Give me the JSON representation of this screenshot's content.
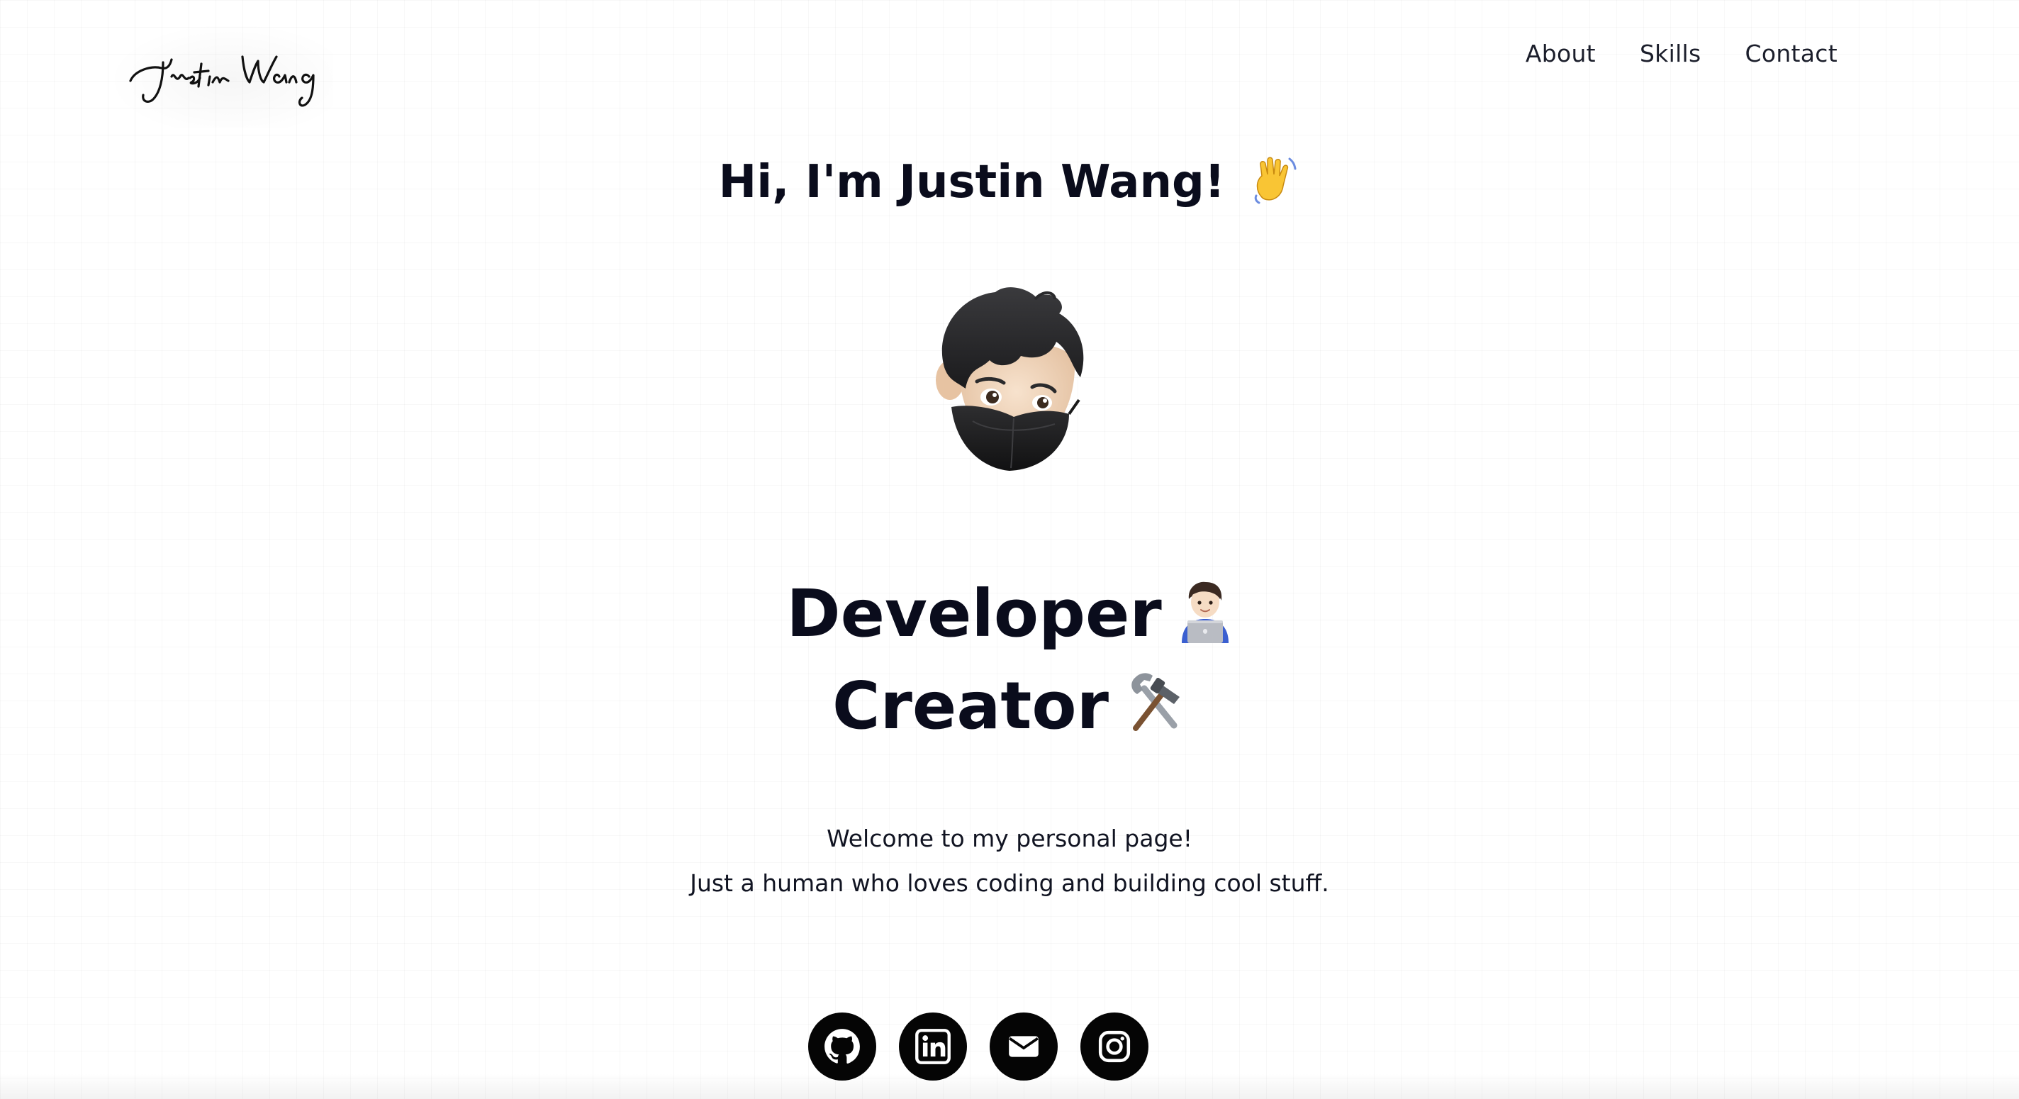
{
  "header": {
    "logo_text": "Justin Wang",
    "nav": [
      "About",
      "Skills",
      "Contact"
    ]
  },
  "hero": {
    "greeting": "Hi, I'm Justin Wang!",
    "greeting_emoji": "waving-hand",
    "roles": [
      {
        "label": "Developer",
        "emoji": "technologist-laptop"
      },
      {
        "label": "Creator",
        "emoji": "hammer-and-wrench"
      }
    ],
    "intro": [
      "Welcome to my personal page!",
      "Just a human who loves coding and building cool stuff."
    ]
  },
  "social": [
    {
      "icon": "github-icon"
    },
    {
      "icon": "linkedin-icon"
    },
    {
      "icon": "email-icon"
    },
    {
      "icon": "instagram-icon"
    }
  ],
  "colors": {
    "text": "#0a0c1c",
    "background": "#ffffff",
    "icon_bg": "#050505"
  }
}
